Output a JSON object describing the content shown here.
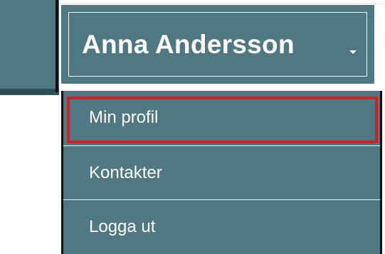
{
  "user_menu": {
    "name": "Anna Andersson"
  },
  "dropdown": {
    "items": [
      {
        "label": "Min profil"
      },
      {
        "label": "Kontakter"
      },
      {
        "label": "Logga ut"
      }
    ]
  },
  "colors": {
    "primary": "#507882",
    "dark_strip": "#2f4f57",
    "highlight": "#d11f28",
    "text": "#ffffff"
  }
}
